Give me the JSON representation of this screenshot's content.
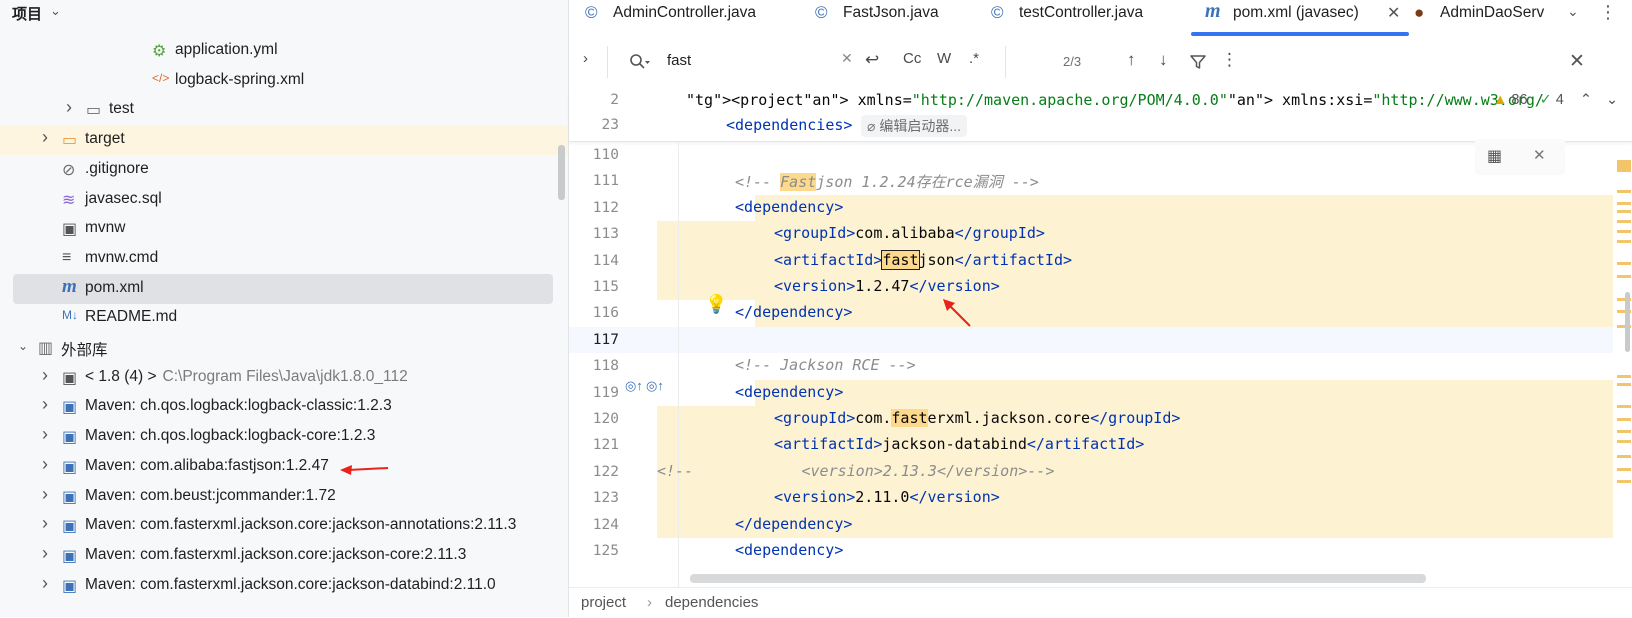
{
  "project": {
    "title": "项目",
    "tree": [
      {
        "label": "application.yml",
        "icon": "spring-config-icon",
        "indent": 4,
        "arrow": ""
      },
      {
        "label": "logback-spring.xml",
        "icon": "xml-file-icon",
        "indent": 4,
        "arrow": ""
      },
      {
        "label": "test",
        "icon": "folder-icon",
        "indent": 3,
        "arrow": "right"
      },
      {
        "label": "target",
        "icon": "folder-orange-icon",
        "indent": 2,
        "arrow": "right",
        "state": "light"
      },
      {
        "label": ".gitignore",
        "icon": "gitignore-icon",
        "indent": 2,
        "arrow": ""
      },
      {
        "label": "javasec.sql",
        "icon": "database-icon",
        "indent": 2,
        "arrow": ""
      },
      {
        "label": "mvnw",
        "icon": "terminal-icon",
        "indent": 2,
        "arrow": ""
      },
      {
        "label": "mvnw.cmd",
        "icon": "text-file-icon",
        "indent": 2,
        "arrow": ""
      },
      {
        "label": "pom.xml",
        "icon": "maven-icon",
        "indent": 2,
        "arrow": "",
        "state": "selected"
      },
      {
        "label": "README.md",
        "icon": "markdown-icon",
        "indent": 2,
        "arrow": ""
      },
      {
        "label": "外部库",
        "icon": "library-icon",
        "indent": 1,
        "arrow": "down"
      },
      {
        "label": "< 1.8 (4) >",
        "path": "C:\\Program Files\\Java\\jdk1.8.0_112",
        "icon": "jdk-icon",
        "indent": 2,
        "arrow": "right"
      },
      {
        "label": "Maven: ch.qos.logback:logback-classic:1.2.3",
        "icon": "maven-lib-icon",
        "indent": 2,
        "arrow": "right"
      },
      {
        "label": "Maven: ch.qos.logback:logback-core:1.2.3",
        "icon": "maven-lib-icon",
        "indent": 2,
        "arrow": "right"
      },
      {
        "label": "Maven: com.alibaba:fastjson:1.2.47",
        "icon": "maven-lib-icon",
        "indent": 2,
        "arrow": "right"
      },
      {
        "label": "Maven: com.beust:jcommander:1.72",
        "icon": "maven-lib-icon",
        "indent": 2,
        "arrow": "right"
      },
      {
        "label": "Maven: com.fasterxml.jackson.core:jackson-annotations:2.11.3",
        "icon": "maven-lib-icon",
        "indent": 2,
        "arrow": "right"
      },
      {
        "label": "Maven: com.fasterxml.jackson.core:jackson-core:2.11.3",
        "icon": "maven-lib-icon",
        "indent": 2,
        "arrow": "right"
      },
      {
        "label": "Maven: com.fasterxml.jackson.core:jackson-databind:2.11.0",
        "icon": "maven-lib-icon",
        "indent": 2,
        "arrow": "right"
      }
    ]
  },
  "tabs": [
    {
      "label": "AdminController.java",
      "icon": "©"
    },
    {
      "label": "FastJson.java",
      "icon": "©"
    },
    {
      "label": "testController.java",
      "icon": "©"
    },
    {
      "label": "pom.xml (javasec)",
      "icon": "m",
      "active": true
    },
    {
      "label": "AdminDaoServ",
      "icon": "●"
    }
  ],
  "find": {
    "value": "fast",
    "count": "2/3",
    "case_label": "Cc",
    "word_label": "W",
    "regex_label": ".*"
  },
  "sticky": [
    {
      "ln": "2",
      "text": "<project xmlns=\"http://maven.apache.org/POM/4.0.0\" xmlns:xsi=\"http://www.w3.org/"
    },
    {
      "ln": "23",
      "text": "<dependencies>",
      "hint": "编辑启动器..."
    }
  ],
  "inspections": {
    "warnings": "86",
    "checks": "4"
  },
  "code": [
    {
      "ln": "110",
      "text": ""
    },
    {
      "ln": "111",
      "text": "<!-- Fastjson 1.2.24存在rce漏洞 -->"
    },
    {
      "ln": "112",
      "text": "<dependency>"
    },
    {
      "ln": "113",
      "text": "<groupId>com.alibaba</groupId>"
    },
    {
      "ln": "114",
      "text": "<artifactId>fastjson</artifactId>"
    },
    {
      "ln": "115",
      "text": "<version>1.2.47</version>"
    },
    {
      "ln": "116",
      "text": "</dependency>"
    },
    {
      "ln": "117",
      "text": ""
    },
    {
      "ln": "118",
      "text": "<!-- Jackson RCE -->"
    },
    {
      "ln": "119",
      "text": "<dependency>"
    },
    {
      "ln": "120",
      "text": "<groupId>com.fasterxml.jackson.core</groupId>"
    },
    {
      "ln": "121",
      "text": "<artifactId>jackson-databind</artifactId>"
    },
    {
      "ln": "122",
      "text": "<!--            <version>2.13.3</version>-->"
    },
    {
      "ln": "123",
      "text": "<version>2.11.0</version>"
    },
    {
      "ln": "124",
      "text": "</dependency>"
    },
    {
      "ln": "125",
      "text": "<dependency>"
    }
  ],
  "breadcrumbs": [
    "project",
    "dependencies"
  ],
  "colors": {
    "accent": "#3574f0",
    "match": "#fcd98c",
    "tag": "#0033b3",
    "attr_value": "#067d17"
  }
}
